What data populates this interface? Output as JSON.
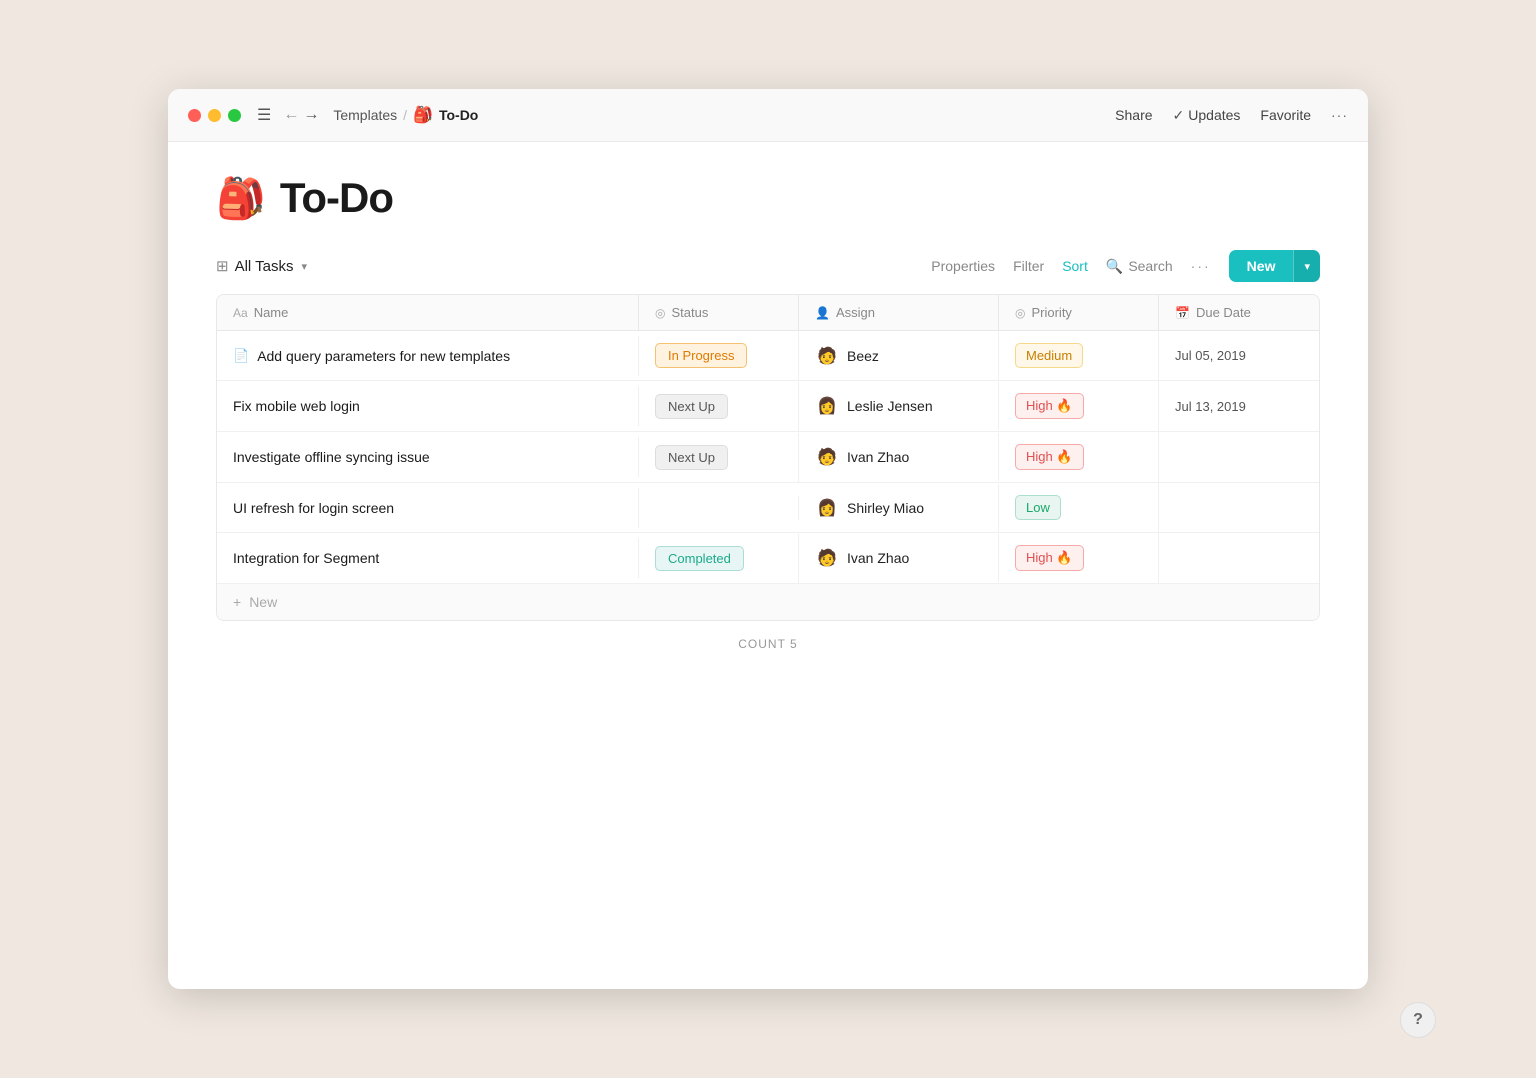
{
  "window": {
    "titlebar": {
      "breadcrumb_parent": "Templates",
      "breadcrumb_sep": "/",
      "page_icon": "🎒",
      "page_title": "To-Do",
      "share_label": "Share",
      "updates_check": "✓",
      "updates_label": "Updates",
      "favorite_label": "Favorite",
      "more_label": "···"
    }
  },
  "page": {
    "icon": "🎒",
    "title": "To-Do"
  },
  "toolbar": {
    "view_icon": "⊞",
    "view_label": "All Tasks",
    "properties_label": "Properties",
    "filter_label": "Filter",
    "sort_label": "Sort",
    "search_label": "Search",
    "more_label": "···",
    "new_label": "New"
  },
  "table": {
    "columns": [
      {
        "id": "name",
        "icon": "Aa",
        "label": "Name"
      },
      {
        "id": "status",
        "icon": "◎",
        "label": "Status"
      },
      {
        "id": "assign",
        "icon": "👤",
        "label": "Assign"
      },
      {
        "id": "priority",
        "icon": "◎",
        "label": "Priority"
      },
      {
        "id": "due_date",
        "icon": "📅",
        "label": "Due Date"
      }
    ],
    "rows": [
      {
        "id": 1,
        "name": "Add query parameters for new templates",
        "name_icon": "📄",
        "status": "In Progress",
        "status_type": "in-progress",
        "assignee_avatar": "🧑",
        "assignee": "Beez",
        "priority": "Medium",
        "priority_type": "medium",
        "priority_emoji": "",
        "due_date": "Jul 05, 2019"
      },
      {
        "id": 2,
        "name": "Fix mobile web login",
        "name_icon": "",
        "status": "Next Up",
        "status_type": "next-up",
        "assignee_avatar": "👩",
        "assignee": "Leslie Jensen",
        "priority": "High 🔥",
        "priority_type": "high",
        "priority_emoji": "🔥",
        "due_date": "Jul 13, 2019"
      },
      {
        "id": 3,
        "name": "Investigate offline syncing issue",
        "name_icon": "",
        "status": "Next Up",
        "status_type": "next-up",
        "assignee_avatar": "🧑",
        "assignee": "Ivan Zhao",
        "priority": "High 🔥",
        "priority_type": "high",
        "priority_emoji": "🔥",
        "due_date": ""
      },
      {
        "id": 4,
        "name": "UI refresh for login screen",
        "name_icon": "",
        "status": "",
        "status_type": "none",
        "assignee_avatar": "👩",
        "assignee": "Shirley Miao",
        "priority": "Low",
        "priority_type": "low",
        "priority_emoji": "",
        "due_date": ""
      },
      {
        "id": 5,
        "name": "Integration for Segment",
        "name_icon": "",
        "status": "Completed",
        "status_type": "completed",
        "assignee_avatar": "🧑",
        "assignee": "Ivan Zhao",
        "priority": "High 🔥",
        "priority_type": "high",
        "priority_emoji": "🔥",
        "due_date": ""
      }
    ],
    "add_new_label": "New",
    "count_label": "COUNT",
    "count_value": "5"
  },
  "help": {
    "label": "?"
  }
}
